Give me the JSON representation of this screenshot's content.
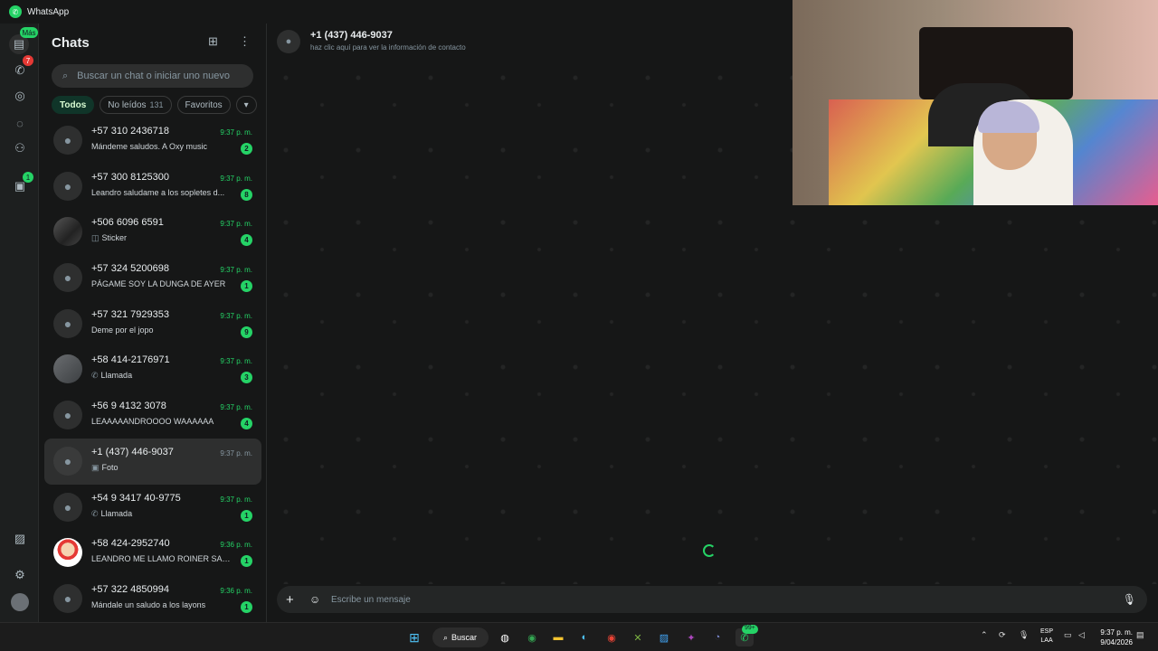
{
  "window": {
    "title": "WhatsApp"
  },
  "rail": {
    "chats_badge": "Más",
    "calls_badge": "7",
    "archive_badge": "1"
  },
  "chatlist": {
    "title": "Chats",
    "search_placeholder": "Buscar un chat o iniciar uno nuevo",
    "filters": [
      {
        "label": "Todos"
      },
      {
        "label": "No leídos",
        "count": "131"
      },
      {
        "label": "Favoritos"
      }
    ],
    "chats": [
      {
        "name": "+57 310 2436718",
        "time": "9:37 p. m.",
        "preview": "Mándeme saludos.  A Oxy music",
        "unread": "2",
        "preview_icon": ""
      },
      {
        "name": "+57 300 8125300",
        "time": "9:37 p. m.",
        "preview": "Leandro saludame a los sopletes d...",
        "unread": "8",
        "preview_icon": ""
      },
      {
        "name": "+506 6096 6591",
        "time": "9:37 p. m.",
        "preview": "Sticker",
        "unread": "4",
        "preview_icon": "sticker-icon"
      },
      {
        "name": "+57 324 5200698",
        "time": "9:37 p. m.",
        "preview": "PÁGAME SOY LA DUNGA DE AYER",
        "unread": "1",
        "preview_icon": ""
      },
      {
        "name": "+57 321 7929353",
        "time": "9:37 p. m.",
        "preview": "Deme por el jopo",
        "unread": "9",
        "preview_icon": ""
      },
      {
        "name": "+58 414-2176971",
        "time": "9:37 p. m.",
        "preview": "Llamada",
        "unread": "3",
        "preview_icon": "phone-icon"
      },
      {
        "name": "+56 9 4132 3078",
        "time": "9:37 p. m.",
        "preview": "LEAAAAANDROOOO WAAAAAA",
        "unread": "4",
        "preview_icon": ""
      },
      {
        "name": "+1 (437) 446-9037",
        "time": "9:37 p. m.",
        "preview": "Foto",
        "unread": "",
        "preview_icon": "photo-icon"
      },
      {
        "name": "+54 9 3417 40-9775",
        "time": "9:37 p. m.",
        "preview": "Llamada",
        "unread": "1",
        "preview_icon": "phone-icon"
      },
      {
        "name": "+58 424-2952740",
        "time": "9:36 p. m.",
        "preview": "LEANDRO ME LLAMO ROINER SAL...",
        "unread": "1",
        "preview_icon": ""
      },
      {
        "name": "+57 322 4850994",
        "time": "9:36 p. m.",
        "preview": "Mándale un saludo a los layons",
        "unread": "1",
        "preview_icon": ""
      }
    ]
  },
  "conversation": {
    "contact_name": "+1 (437) 446-9037",
    "contact_subtitle": "haz clic aquí para ver la información de contacto",
    "composer_placeholder": "Escribe un mensaje"
  },
  "taskbar": {
    "search_label": "Buscar",
    "lang_line1": "ESP",
    "lang_line2": "LAA",
    "time": "9:37 p. m.",
    "date": "9/04/2026",
    "whatsapp_badge": "99+"
  },
  "colors": {
    "accent": "#25d366",
    "background": "#161717",
    "selected_row": "#2e2f2f",
    "active_chip": "#103529"
  }
}
